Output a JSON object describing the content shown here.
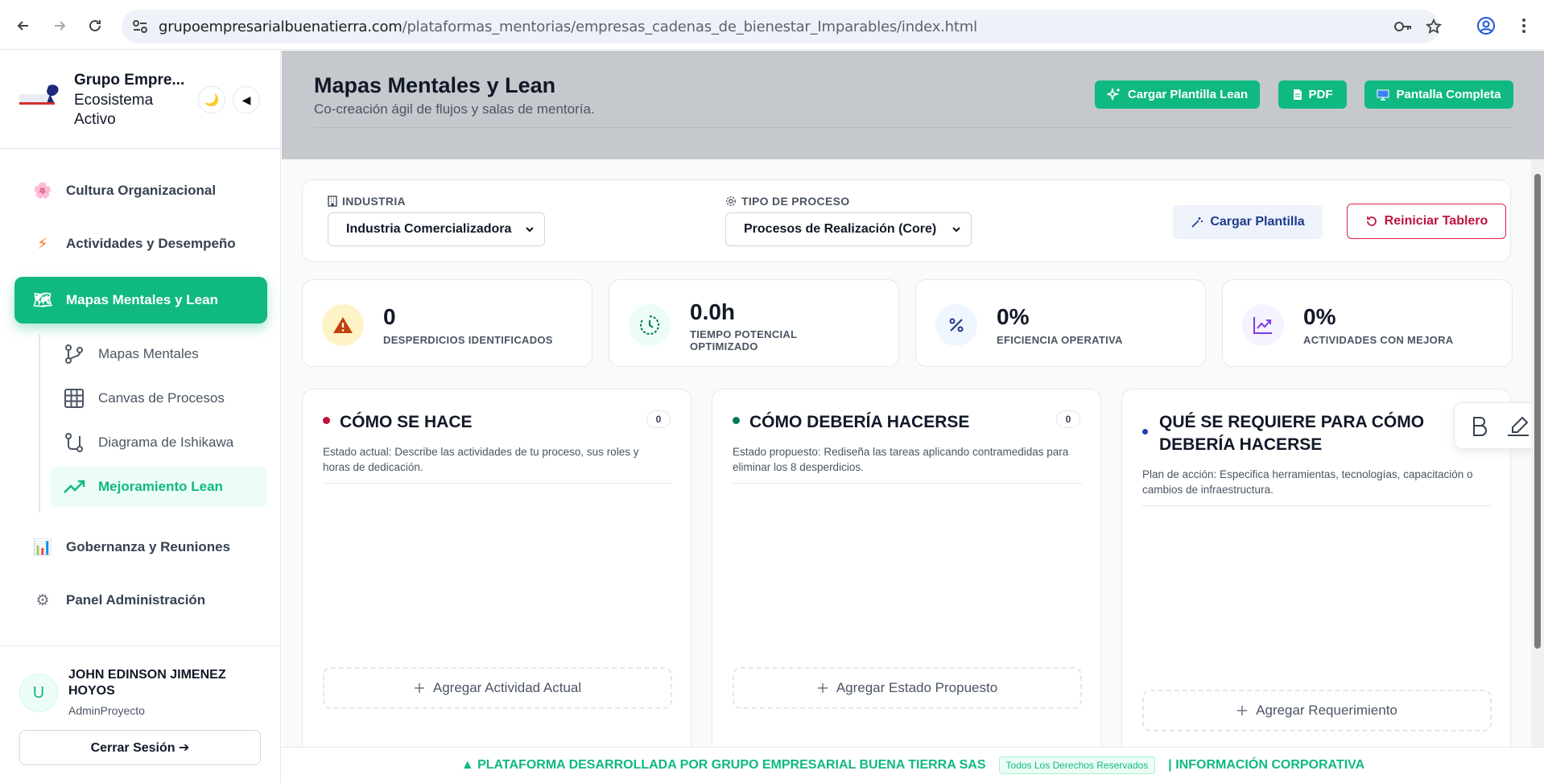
{
  "browser": {
    "url_host": "grupoempresarialbuenatierra.com",
    "url_path": "/plataformas_mentorias/empresas_cadenas_de_bienestar_Imparables/index.html"
  },
  "sidebar": {
    "brand_title": "Grupo Empre...",
    "brand_subtitle": "Ecosistema Activo",
    "theme_icon": "🌙",
    "collapse_icon": "◀",
    "items": [
      {
        "label": "Cultura Organizacional",
        "icon": "🌸"
      },
      {
        "label": "Actividades y Desempeño",
        "icon": "⚡"
      },
      {
        "label": "Mapas Mentales y Lean",
        "icon": "🗺"
      },
      {
        "label": "Gobernanza y Reuniones",
        "icon": "📊"
      },
      {
        "label": "Panel Administración",
        "icon": "⚙"
      }
    ],
    "sub_items": [
      {
        "label": "Mapas Mentales"
      },
      {
        "label": "Canvas de Procesos"
      },
      {
        "label": "Diagrama de Ishikawa"
      },
      {
        "label": "Mejoramiento Lean"
      }
    ],
    "user": {
      "initial": "U",
      "name": "JOHN EDINSON JIMENEZ HOYOS",
      "role": "AdminProyecto",
      "logout": "Cerrar Sesión ➔"
    }
  },
  "header": {
    "title": "Mapas Mentales y Lean",
    "subtitle": "Co-creación ágil de flujos y salas de mentoría.",
    "buttons": {
      "load_lean": "Cargar Plantilla Lean",
      "pdf": "PDF",
      "fullscreen": "Pantalla Completa"
    }
  },
  "filters": {
    "industry_label": "INDUSTRIA",
    "industry_value": "Industria Comercializadora",
    "process_label": "TIPO DE PROCESO",
    "process_value": "Procesos de Realización (Core)",
    "load_template": "Cargar Plantilla",
    "reset": "Reiniciar Tablero"
  },
  "stats": [
    {
      "value": "0",
      "label": "DESPERDICIOS IDENTIFICADOS"
    },
    {
      "value": "0.0h",
      "label": "TIEMPO POTENCIAL OPTIMIZADO"
    },
    {
      "value": "0%",
      "label": "EFICIENCIA OPERATIVA"
    },
    {
      "value": "0%",
      "label": "ACTIVIDADES CON MEJORA"
    }
  ],
  "columns": [
    {
      "title": "CÓMO SE HACE",
      "count": "0",
      "desc": "Estado actual: Describe las actividades de tu proceso, sus roles y horas de dedicación.",
      "add": "Agregar Actividad Actual"
    },
    {
      "title": "CÓMO DEBERÍA HACERSE",
      "count": "0",
      "desc": "Estado propuesto: Rediseña las tareas aplicando contramedidas para eliminar los 8 desperdicios.",
      "add": "Agregar Estado Propuesto"
    },
    {
      "title": "QUÉ SE REQUIERE PARA CÓMO DEBERÍA HACERSE",
      "desc": "Plan de acción: Especifica herramientas, tecnologías, capacitación o cambios de infraestructura.",
      "add": "Agregar Requerimiento"
    }
  ],
  "footer": {
    "main": "▲ PLATAFORMA DESARROLLADA POR GRUPO EMPRESARIAL BUENA TIERRA SAS",
    "rights": "Todos Los Derechos Reservados",
    "info": "| INFORMACIÓN CORPORATIVA"
  },
  "colors": {
    "accent": "#10b981",
    "danger": "#be123c",
    "header_bg": "#c5c8cd"
  }
}
